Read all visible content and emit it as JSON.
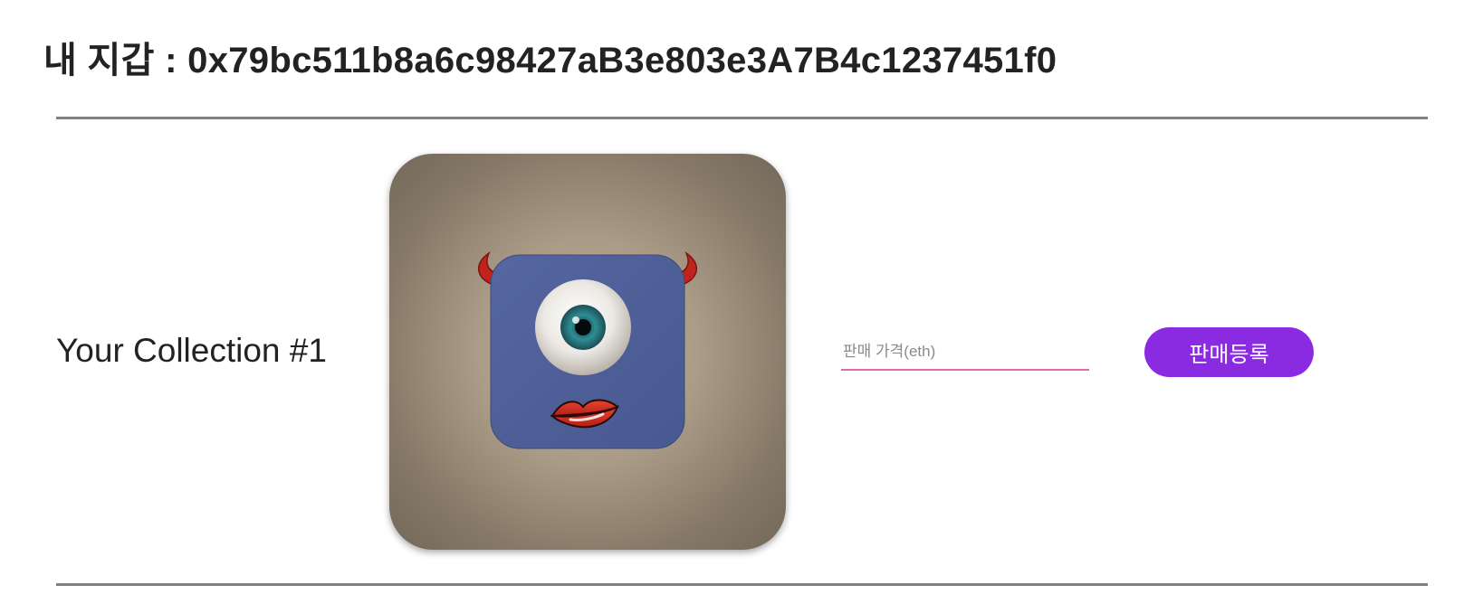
{
  "header": {
    "wallet_title": "내 지갑 : 0x79bc511b8a6c98427aB3e803e3A7B4c1237451f0"
  },
  "collection": {
    "label": "Your Collection #1",
    "image_icon": "cyclops-monster-nft-image"
  },
  "sale": {
    "price_placeholder": "판매 가격(eth)",
    "price_value": "",
    "register_label": "판매등록"
  },
  "colors": {
    "accent_button": "#8a2be2",
    "input_underline": "#e066b8",
    "divider": "#808080",
    "card_background": "#aa9b87",
    "monster_body": "#4f5f98"
  }
}
